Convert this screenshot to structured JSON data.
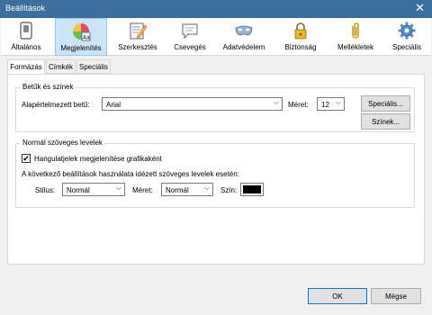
{
  "window": {
    "title": "Beállítások",
    "close_glyph": "✕"
  },
  "toolbar": {
    "items": [
      {
        "label": "Általános",
        "icon": "switch-icon"
      },
      {
        "label": "Megjelenítés",
        "icon": "palette-icon",
        "active": true
      },
      {
        "label": "Szerkesztés",
        "icon": "edit-icon"
      },
      {
        "label": "Csevegés",
        "icon": "chat-icon"
      },
      {
        "label": "Adatvédelem",
        "icon": "mask-icon"
      },
      {
        "label": "Biztonság",
        "icon": "lock-icon"
      },
      {
        "label": "Mellékletek",
        "icon": "paperclip-icon"
      },
      {
        "label": "Speciális",
        "icon": "gear-icon"
      }
    ]
  },
  "tabs": [
    {
      "label": "Formázás",
      "active": true
    },
    {
      "label": "Címkék"
    },
    {
      "label": "Speciális"
    }
  ],
  "fonts_group": {
    "title": "Betűk és színek",
    "default_font_label": "Alapértelmezett betű:",
    "default_font_value": "Arial",
    "size_label": "Méret:",
    "size_value": "12",
    "advanced_button": "Speciális...",
    "colors_button": "Színek..."
  },
  "plain_group": {
    "title": "Normál szöveges levelek",
    "smileys_checkbox": "Hangulatjelek megjelenítése grafikaként",
    "smileys_checked": true,
    "quoted_heading": "A következő beállítások használata idézett szöveges levelek esetén:",
    "style_label": "Stílus:",
    "style_value": "Normál",
    "size_label": "Méret:",
    "size_value": "Normál",
    "color_label": "Szín:",
    "color_value": "#000000"
  },
  "footer": {
    "ok_button": "OK",
    "cancel_button": "Mégse"
  },
  "glyphs": {
    "dropdown_arrow": "⌵",
    "checkmark": "✔"
  }
}
